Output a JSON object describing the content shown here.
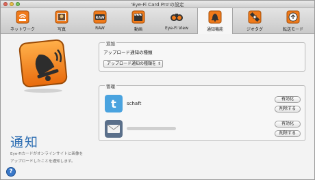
{
  "window": {
    "title": "'Eye-Fi Card Pro'の設定"
  },
  "toolbar": {
    "tabs": [
      {
        "label": "ネットワーク",
        "icon": "wifi-router-icon"
      },
      {
        "label": "写真",
        "icon": "photo-film-icon"
      },
      {
        "label": "RAW",
        "icon": "raw-icon"
      },
      {
        "label": "動画",
        "icon": "video-clapper-icon"
      },
      {
        "label": "Eye-Fi View",
        "icon": "binoculars-icon"
      },
      {
        "label": "通知機能",
        "icon": "bell-icon",
        "active": true
      },
      {
        "label": "ジオタグ",
        "icon": "satellite-icon"
      },
      {
        "label": "転送モード",
        "icon": "transfer-mode-icon"
      }
    ]
  },
  "left": {
    "heading": "通知",
    "description_line1": "Eye-Fiカードがオンラインサイトに画像を",
    "description_line2": "アップロードしたことを通知します。"
  },
  "add": {
    "title": "追加",
    "label": "アップロード通知の種類",
    "select_value": "アップロード通知の種類を"
  },
  "manage": {
    "title": "管理",
    "accounts": [
      {
        "name": "schaft",
        "service": "twitter",
        "enable_label": "有効化",
        "delete_label": "削除する"
      },
      {
        "name": "",
        "service": "email",
        "enable_label": "有効化",
        "delete_label": "削除する"
      }
    ]
  },
  "help": {
    "label": "?"
  },
  "colors": {
    "accent_orange": "#f07a1a",
    "heading_blue": "#2f6fb3",
    "twitter_blue": "#4aa3df"
  }
}
